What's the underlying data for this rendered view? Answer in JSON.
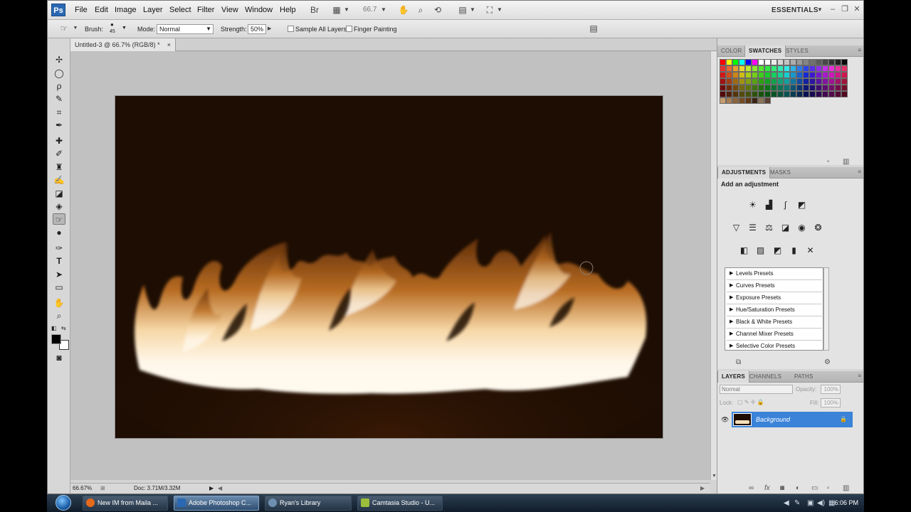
{
  "app": {
    "logo": "Ps",
    "menus": [
      "File",
      "Edit",
      "Image",
      "Layer",
      "Select",
      "Filter",
      "View",
      "Window",
      "Help"
    ],
    "zoom": "66.7",
    "workspace": "ESSENTIALS"
  },
  "options": {
    "brush_label": "Brush:",
    "brush_size": "45",
    "mode_label": "Mode:",
    "mode_value": "Normal",
    "strength_label": "Strength:",
    "strength_value": "50%",
    "sample_all_layers": "Sample All Layers",
    "finger_painting": "Finger Painting"
  },
  "document": {
    "tab_title": "Untitled-3 @ 66.7% (RGB/8) *",
    "status_zoom": "66.67%",
    "doc_size": "Doc: 3.71M/3.32M"
  },
  "panels": {
    "color_tabs": [
      "COLOR",
      "SWATCHES",
      "STYLES"
    ],
    "adjustment_tabs": [
      "ADJUSTMENTS",
      "MASKS"
    ],
    "add_adjustment": "Add an adjustment",
    "presets": [
      "Levels Presets",
      "Curves Presets",
      "Exposure Presets",
      "Hue/Saturation Presets",
      "Black & White Presets",
      "Channel Mixer Presets",
      "Selective Color Presets"
    ],
    "layer_tabs": [
      "LAYERS",
      "CHANNELS",
      "PATHS"
    ],
    "blend_mode": "Normal",
    "opacity_label": "Opacity:",
    "opacity_value": "100%",
    "lock_label": "Lock:",
    "fill_label": "Fill:",
    "fill_value": "100%",
    "layer_name": "Background"
  },
  "taskbar": {
    "items": [
      "New IM from Maila ...",
      "Adobe Photoshop C...",
      "Ryan's Library",
      "Camtasia Studio - U..."
    ],
    "clock": "6:06 PM"
  },
  "colors": {
    "canvas_bg": "#1d0d03",
    "flame": "#fff3e0",
    "layer_selected": "#3a83d8"
  }
}
